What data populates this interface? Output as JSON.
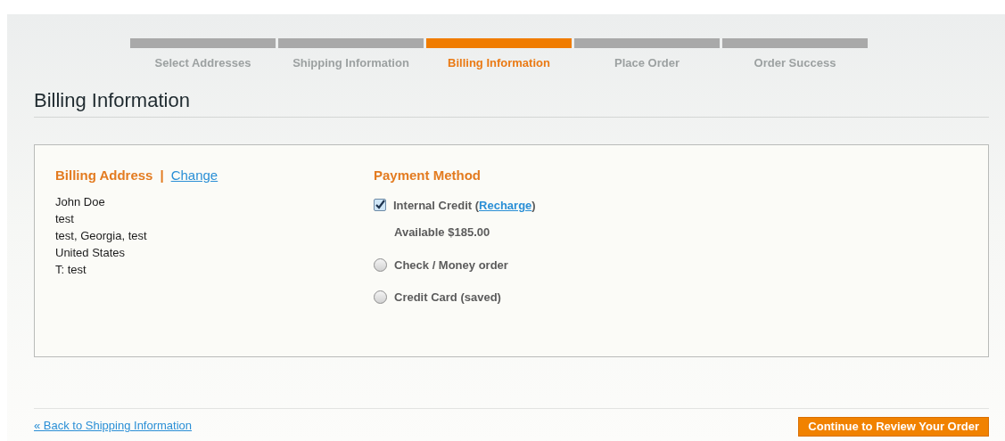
{
  "steps": [
    {
      "label": "Select Addresses",
      "selected": false
    },
    {
      "label": "Shipping Information",
      "selected": false
    },
    {
      "label": "Billing Information",
      "selected": true
    },
    {
      "label": "Place Order",
      "selected": false
    },
    {
      "label": "Order Success",
      "selected": false
    }
  ],
  "title": "Billing Information",
  "billing_address": {
    "heading": "Billing Address",
    "separator": "|",
    "change_link": "Change",
    "lines": [
      "John Doe",
      "test",
      "test, Georgia, test",
      "United States",
      "T: test"
    ]
  },
  "payment_method": {
    "heading": "Payment Method",
    "options": [
      {
        "kind": "checkbox",
        "label": "Internal Credit (",
        "link": "Recharge",
        "suffix": ")",
        "checked": true,
        "note": "Available $185.00"
      },
      {
        "kind": "radio",
        "label": "Check / Money order",
        "checked": false
      },
      {
        "kind": "radio",
        "label": "Credit Card (saved)",
        "checked": false
      }
    ]
  },
  "back_link": "« Back to Shipping Information",
  "continue_button": "Continue to Review Your Order"
}
